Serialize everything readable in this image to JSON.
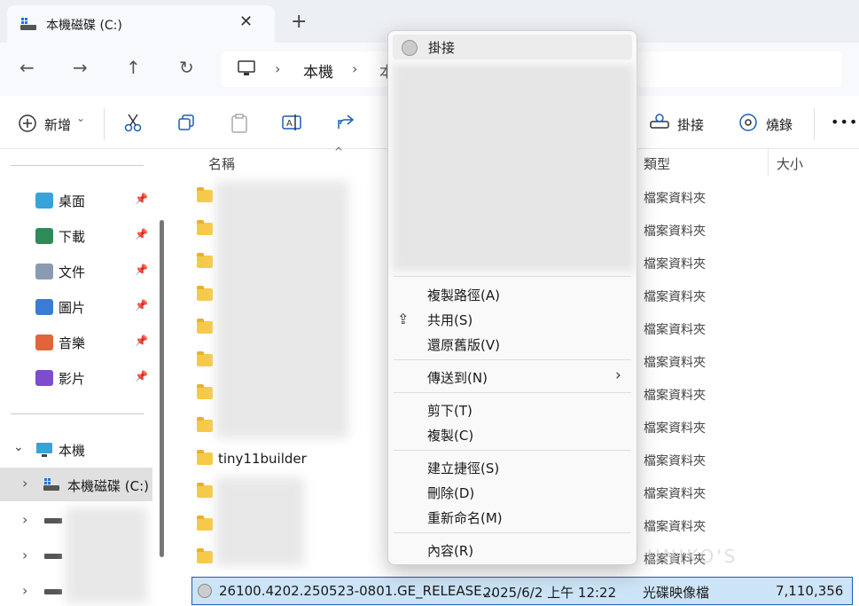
{
  "tab": {
    "title": "本機磁碟 (C:)",
    "close": "✕",
    "new": "+"
  },
  "nav": {
    "back": "←",
    "forward": "→",
    "up": "↑",
    "refresh": "↻",
    "sep": "›",
    "crumb1": "本機",
    "crumb2": "本"
  },
  "toolbar": {
    "new_label": "新增",
    "new_chev": "⌄",
    "mount_label": "掛接",
    "burn_label": "燒錄",
    "more": "•••"
  },
  "sidebar": {
    "quick": [
      {
        "label": "桌面",
        "color": "#36a3d9"
      },
      {
        "label": "下載",
        "color": "#2e8b57"
      },
      {
        "label": "文件",
        "color": "#8a9bb0"
      },
      {
        "label": "圖片",
        "color": "#3a7bd5"
      },
      {
        "label": "音樂",
        "color": "#e0663a"
      },
      {
        "label": "影片",
        "color": "#7c4dcc"
      }
    ],
    "pc": "本機",
    "drive": "本機磁碟 (C:)",
    "pin": "📌",
    "chev_down": "⌄",
    "chev_right": "›"
  },
  "columns": {
    "name": "名稱",
    "type": "類型",
    "size": "大小"
  },
  "rows": [
    {
      "name": "",
      "type": "檔案資料夾"
    },
    {
      "name": "",
      "type": "檔案資料夾"
    },
    {
      "name": "",
      "type": "檔案資料夾"
    },
    {
      "name": "",
      "type": "檔案資料夾"
    },
    {
      "name": "",
      "type": "檔案資料夾"
    },
    {
      "name": "",
      "type": "檔案資料夾"
    },
    {
      "name": "",
      "type": "檔案資料夾"
    },
    {
      "name": "",
      "type": "檔案資料夾"
    },
    {
      "name": "tiny11builder",
      "type": "檔案資料夾"
    },
    {
      "name": "",
      "type": "檔案資料夾"
    },
    {
      "name": "",
      "type": "檔案資料夾"
    },
    {
      "name": "",
      "type": "檔案資料夾"
    }
  ],
  "selected": {
    "name": "26100.4202.250523-0801.GE_RELEASE...",
    "date": "2025/6/2 上午 12:22",
    "type": "光碟映像檔",
    "size": "7,110,356 ..."
  },
  "context_menu": {
    "top": "掛接",
    "items": [
      "複製路徑(A)",
      "共用(S)",
      "還原舊版(V)",
      "傳送到(N)",
      "剪下(T)",
      "複製(C)",
      "建立捷徑(S)",
      "刪除(D)",
      "重新命名(M)",
      "內容(R)"
    ],
    "submenu_arrow": "›",
    "share_icon": "⇪"
  },
  "watermark": "UNIKO'S"
}
